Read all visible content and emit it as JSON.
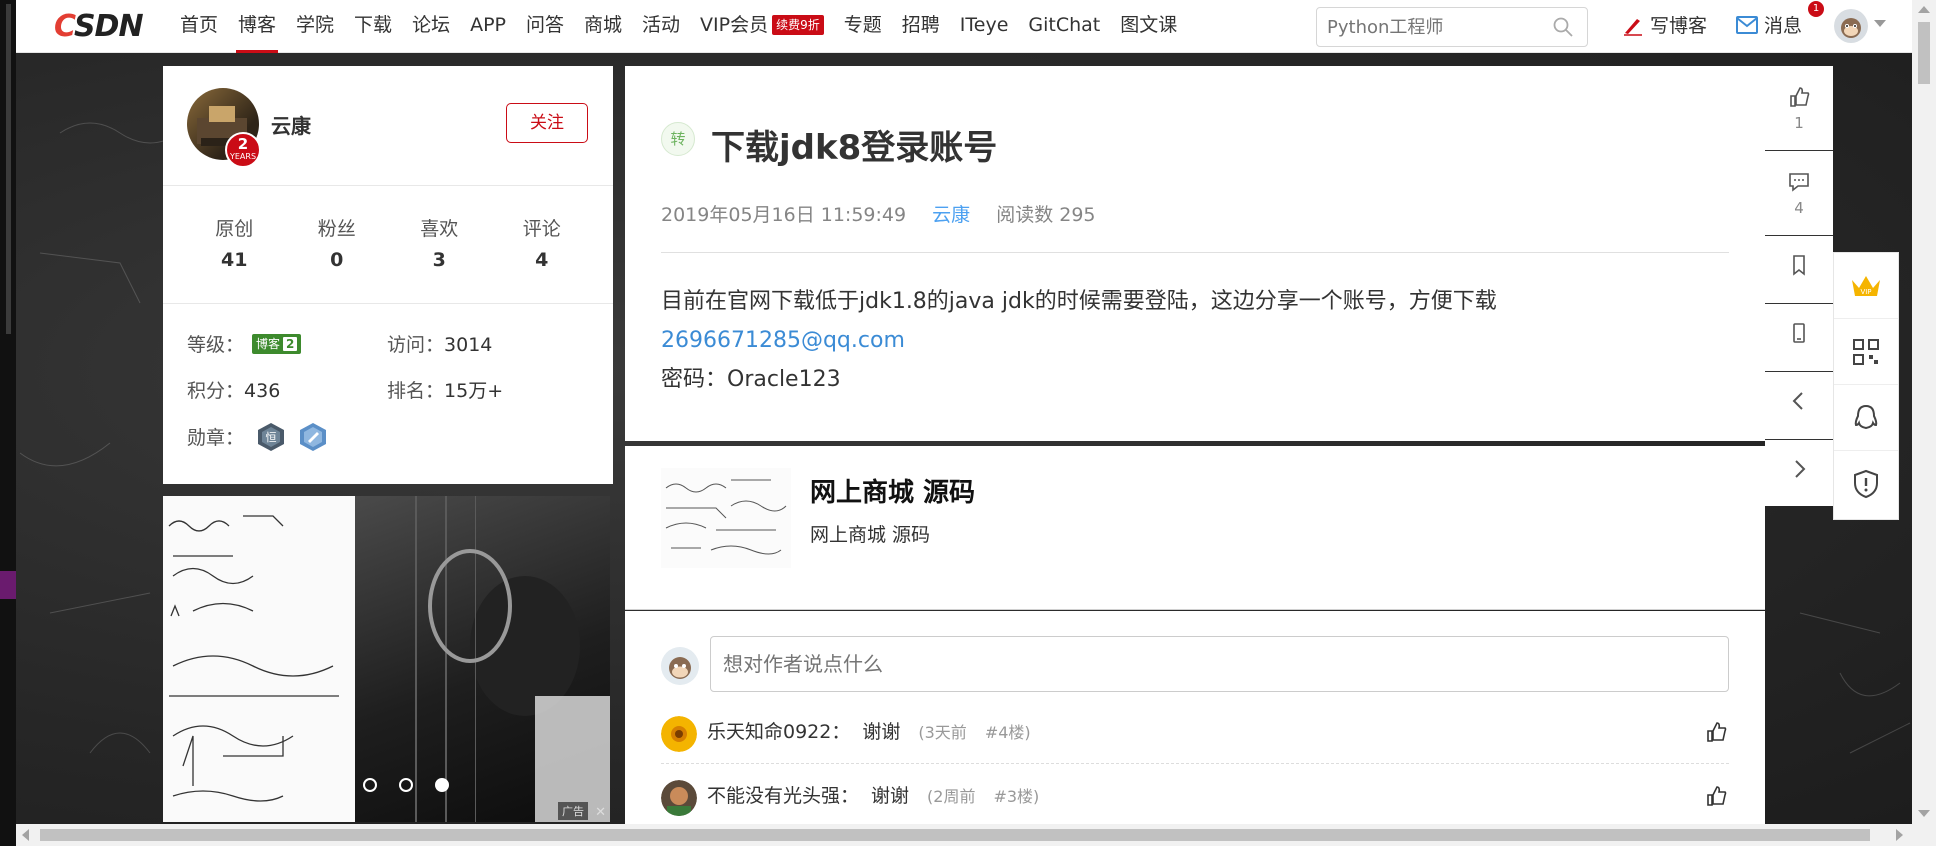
{
  "header": {
    "logo": "CSDN",
    "nav": [
      {
        "label": "首页",
        "active": false
      },
      {
        "label": "博客",
        "active": true
      },
      {
        "label": "学院",
        "active": false
      },
      {
        "label": "下载",
        "active": false
      },
      {
        "label": "论坛",
        "active": false
      },
      {
        "label": "APP",
        "active": false
      },
      {
        "label": "问答",
        "active": false
      },
      {
        "label": "商城",
        "active": false
      },
      {
        "label": "活动",
        "active": false
      },
      {
        "label": "VIP会员",
        "active": false
      },
      {
        "label": "专题",
        "active": false
      },
      {
        "label": "招聘",
        "active": false
      },
      {
        "label": "ITeye",
        "active": false
      },
      {
        "label": "GitChat",
        "active": false
      },
      {
        "label": "图文课",
        "active": false
      }
    ],
    "vip_badge": "续费9折",
    "search_placeholder": "Python工程师",
    "write_label": "写博客",
    "message_label": "消息",
    "message_count": "1"
  },
  "profile": {
    "name": "云康",
    "years": "2",
    "years_label": "YEARS",
    "follow_label": "关注",
    "stats": [
      {
        "label": "原创",
        "value": "41"
      },
      {
        "label": "粉丝",
        "value": "0"
      },
      {
        "label": "喜欢",
        "value": "3"
      },
      {
        "label": "评论",
        "value": "4"
      }
    ],
    "level_label": "等级：",
    "level_badge": "博客",
    "level_num": "2",
    "visits_label": "访问：",
    "visits": "3014",
    "points_label": "积分：",
    "points": "436",
    "rank_label": "排名：",
    "rank": "15万+",
    "medals_label": "勋章："
  },
  "ad": {
    "tag": "广告",
    "close": "✕"
  },
  "article": {
    "tag": "转",
    "title": "下载jdk8登录账号",
    "date": "2019年05月16日 11:59:49",
    "author": "云康",
    "reads": "阅读数 295",
    "line1": "目前在官网下载低于jdk1.8的java jdk的时候需要登陆，这边分享一个账号，方便下载",
    "email": "2696671285@qq.com",
    "line3": "密码：Oracle123"
  },
  "recommend": {
    "title": "网上商城 源码",
    "desc": "网上商城 源码"
  },
  "comments": {
    "placeholder": "想对作者说点什么",
    "items": [
      {
        "name": "乐天知命0922：",
        "text": "谢谢",
        "time": "(3天前",
        "floor": "#4楼)"
      },
      {
        "name": "不能没有光头强：",
        "text": "谢谢",
        "time": "(2周前",
        "floor": "#3楼)"
      }
    ]
  },
  "actions": {
    "likes": "1",
    "comments": "4"
  },
  "colors": {
    "brand_red": "#ca0c16",
    "link_blue": "#4da1f1",
    "level_green": "#3d8a2d"
  }
}
